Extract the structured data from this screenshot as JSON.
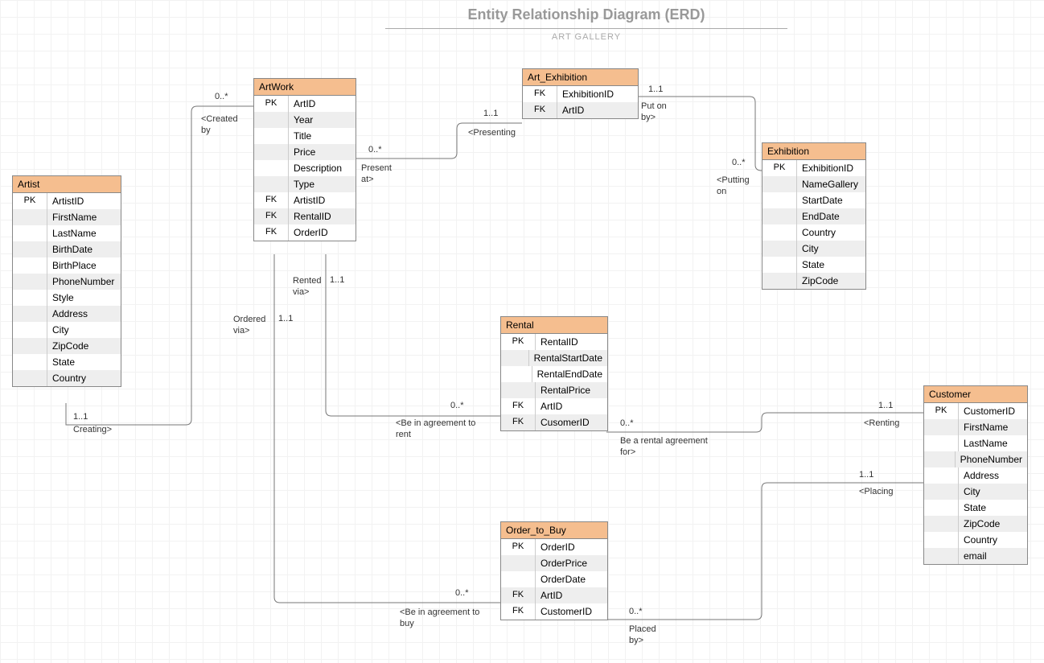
{
  "header": {
    "title": "Entity Relationship Diagram (ERD)",
    "subtitle": "ART GALLERY"
  },
  "entities": {
    "artist": {
      "name": "Artist",
      "rows": [
        {
          "key": "PK",
          "attr": "ArtistID"
        },
        {
          "key": "",
          "attr": "FirstName"
        },
        {
          "key": "",
          "attr": "LastName"
        },
        {
          "key": "",
          "attr": "BirthDate"
        },
        {
          "key": "",
          "attr": "BirthPlace"
        },
        {
          "key": "",
          "attr": "PhoneNumber"
        },
        {
          "key": "",
          "attr": "Style"
        },
        {
          "key": "",
          "attr": "Address"
        },
        {
          "key": "",
          "attr": "City"
        },
        {
          "key": "",
          "attr": "ZipCode"
        },
        {
          "key": "",
          "attr": "State"
        },
        {
          "key": "",
          "attr": "Country"
        }
      ]
    },
    "artwork": {
      "name": "ArtWork",
      "rows": [
        {
          "key": "PK",
          "attr": "ArtID"
        },
        {
          "key": "",
          "attr": "Year"
        },
        {
          "key": "",
          "attr": "Title"
        },
        {
          "key": "",
          "attr": "Price"
        },
        {
          "key": "",
          "attr": "Description"
        },
        {
          "key": "",
          "attr": "Type"
        },
        {
          "key": "FK",
          "attr": "ArtistID"
        },
        {
          "key": "FK",
          "attr": "RentalID"
        },
        {
          "key": "FK",
          "attr": "OrderID"
        }
      ]
    },
    "art_exhibition": {
      "name": "Art_Exhibition",
      "rows": [
        {
          "key": "FK",
          "attr": "ExhibitionID"
        },
        {
          "key": "FK",
          "attr": "ArtID"
        }
      ]
    },
    "exhibition": {
      "name": "Exhibition",
      "rows": [
        {
          "key": "PK",
          "attr": "ExhibitionID"
        },
        {
          "key": "",
          "attr": "NameGallery"
        },
        {
          "key": "",
          "attr": "StartDate"
        },
        {
          "key": "",
          "attr": "EndDate"
        },
        {
          "key": "",
          "attr": "Country"
        },
        {
          "key": "",
          "attr": "City"
        },
        {
          "key": "",
          "attr": "State"
        },
        {
          "key": "",
          "attr": "ZipCode"
        }
      ]
    },
    "rental": {
      "name": "Rental",
      "rows": [
        {
          "key": "PK",
          "attr": "RentalID"
        },
        {
          "key": "",
          "attr": "RentalStartDate"
        },
        {
          "key": "",
          "attr": "RentalEndDate"
        },
        {
          "key": "",
          "attr": "RentalPrice"
        },
        {
          "key": "FK",
          "attr": "ArtID"
        },
        {
          "key": "FK",
          "attr": "CusomerID"
        }
      ]
    },
    "order": {
      "name": "Order_to_Buy",
      "rows": [
        {
          "key": "PK",
          "attr": "OrderID"
        },
        {
          "key": "",
          "attr": "OrderPrice"
        },
        {
          "key": "",
          "attr": "OrderDate"
        },
        {
          "key": "FK",
          "attr": "ArtID"
        },
        {
          "key": "FK",
          "attr": "CustomerID"
        }
      ]
    },
    "customer": {
      "name": "Customer",
      "rows": [
        {
          "key": "PK",
          "attr": "CustomerID"
        },
        {
          "key": "",
          "attr": "FirstName"
        },
        {
          "key": "",
          "attr": "LastName"
        },
        {
          "key": "",
          "attr": "PhoneNumber"
        },
        {
          "key": "",
          "attr": "Address"
        },
        {
          "key": "",
          "attr": "City"
        },
        {
          "key": "",
          "attr": "State"
        },
        {
          "key": "",
          "attr": "ZipCode"
        },
        {
          "key": "",
          "attr": "Country"
        },
        {
          "key": "",
          "attr": "email"
        }
      ]
    }
  },
  "relationships": {
    "artist_artwork": {
      "card_artwork": "0..*",
      "card_artist": "1..1",
      "label_artwork": "<Created\nby",
      "label_artist": "Creating>"
    },
    "artwork_artexh": {
      "card_artwork": "0..*",
      "card_artexh": "1..1",
      "label_artwork": "Present\nat>",
      "label_artexh": "<Presenting"
    },
    "artexh_exhibition": {
      "card_artexh": "1..1",
      "card_exhibition": "0..*",
      "label_artexh": "Put on\nby>",
      "label_exhibition": "<Putting\non"
    },
    "artwork_rental": {
      "card_artwork": "1..1",
      "card_rental": "0..*",
      "label_artwork": "Rented\nvia>",
      "label_rental": "<Be in agreement to\nrent"
    },
    "artwork_order": {
      "card_artwork": "1..1",
      "card_order": "0..*",
      "label_artwork": "Ordered\nvia>",
      "label_order": "<Be in agreement to\nbuy"
    },
    "rental_customer": {
      "card_rental": "0..*",
      "card_customer": "1..1",
      "label_rental": "Be a rental agreement\nfor>",
      "label_customer": "<Renting"
    },
    "order_customer": {
      "card_order": "0..*",
      "card_customer": "1..1",
      "label_order": "Placed\nby>",
      "label_customer": "<Placing"
    }
  }
}
